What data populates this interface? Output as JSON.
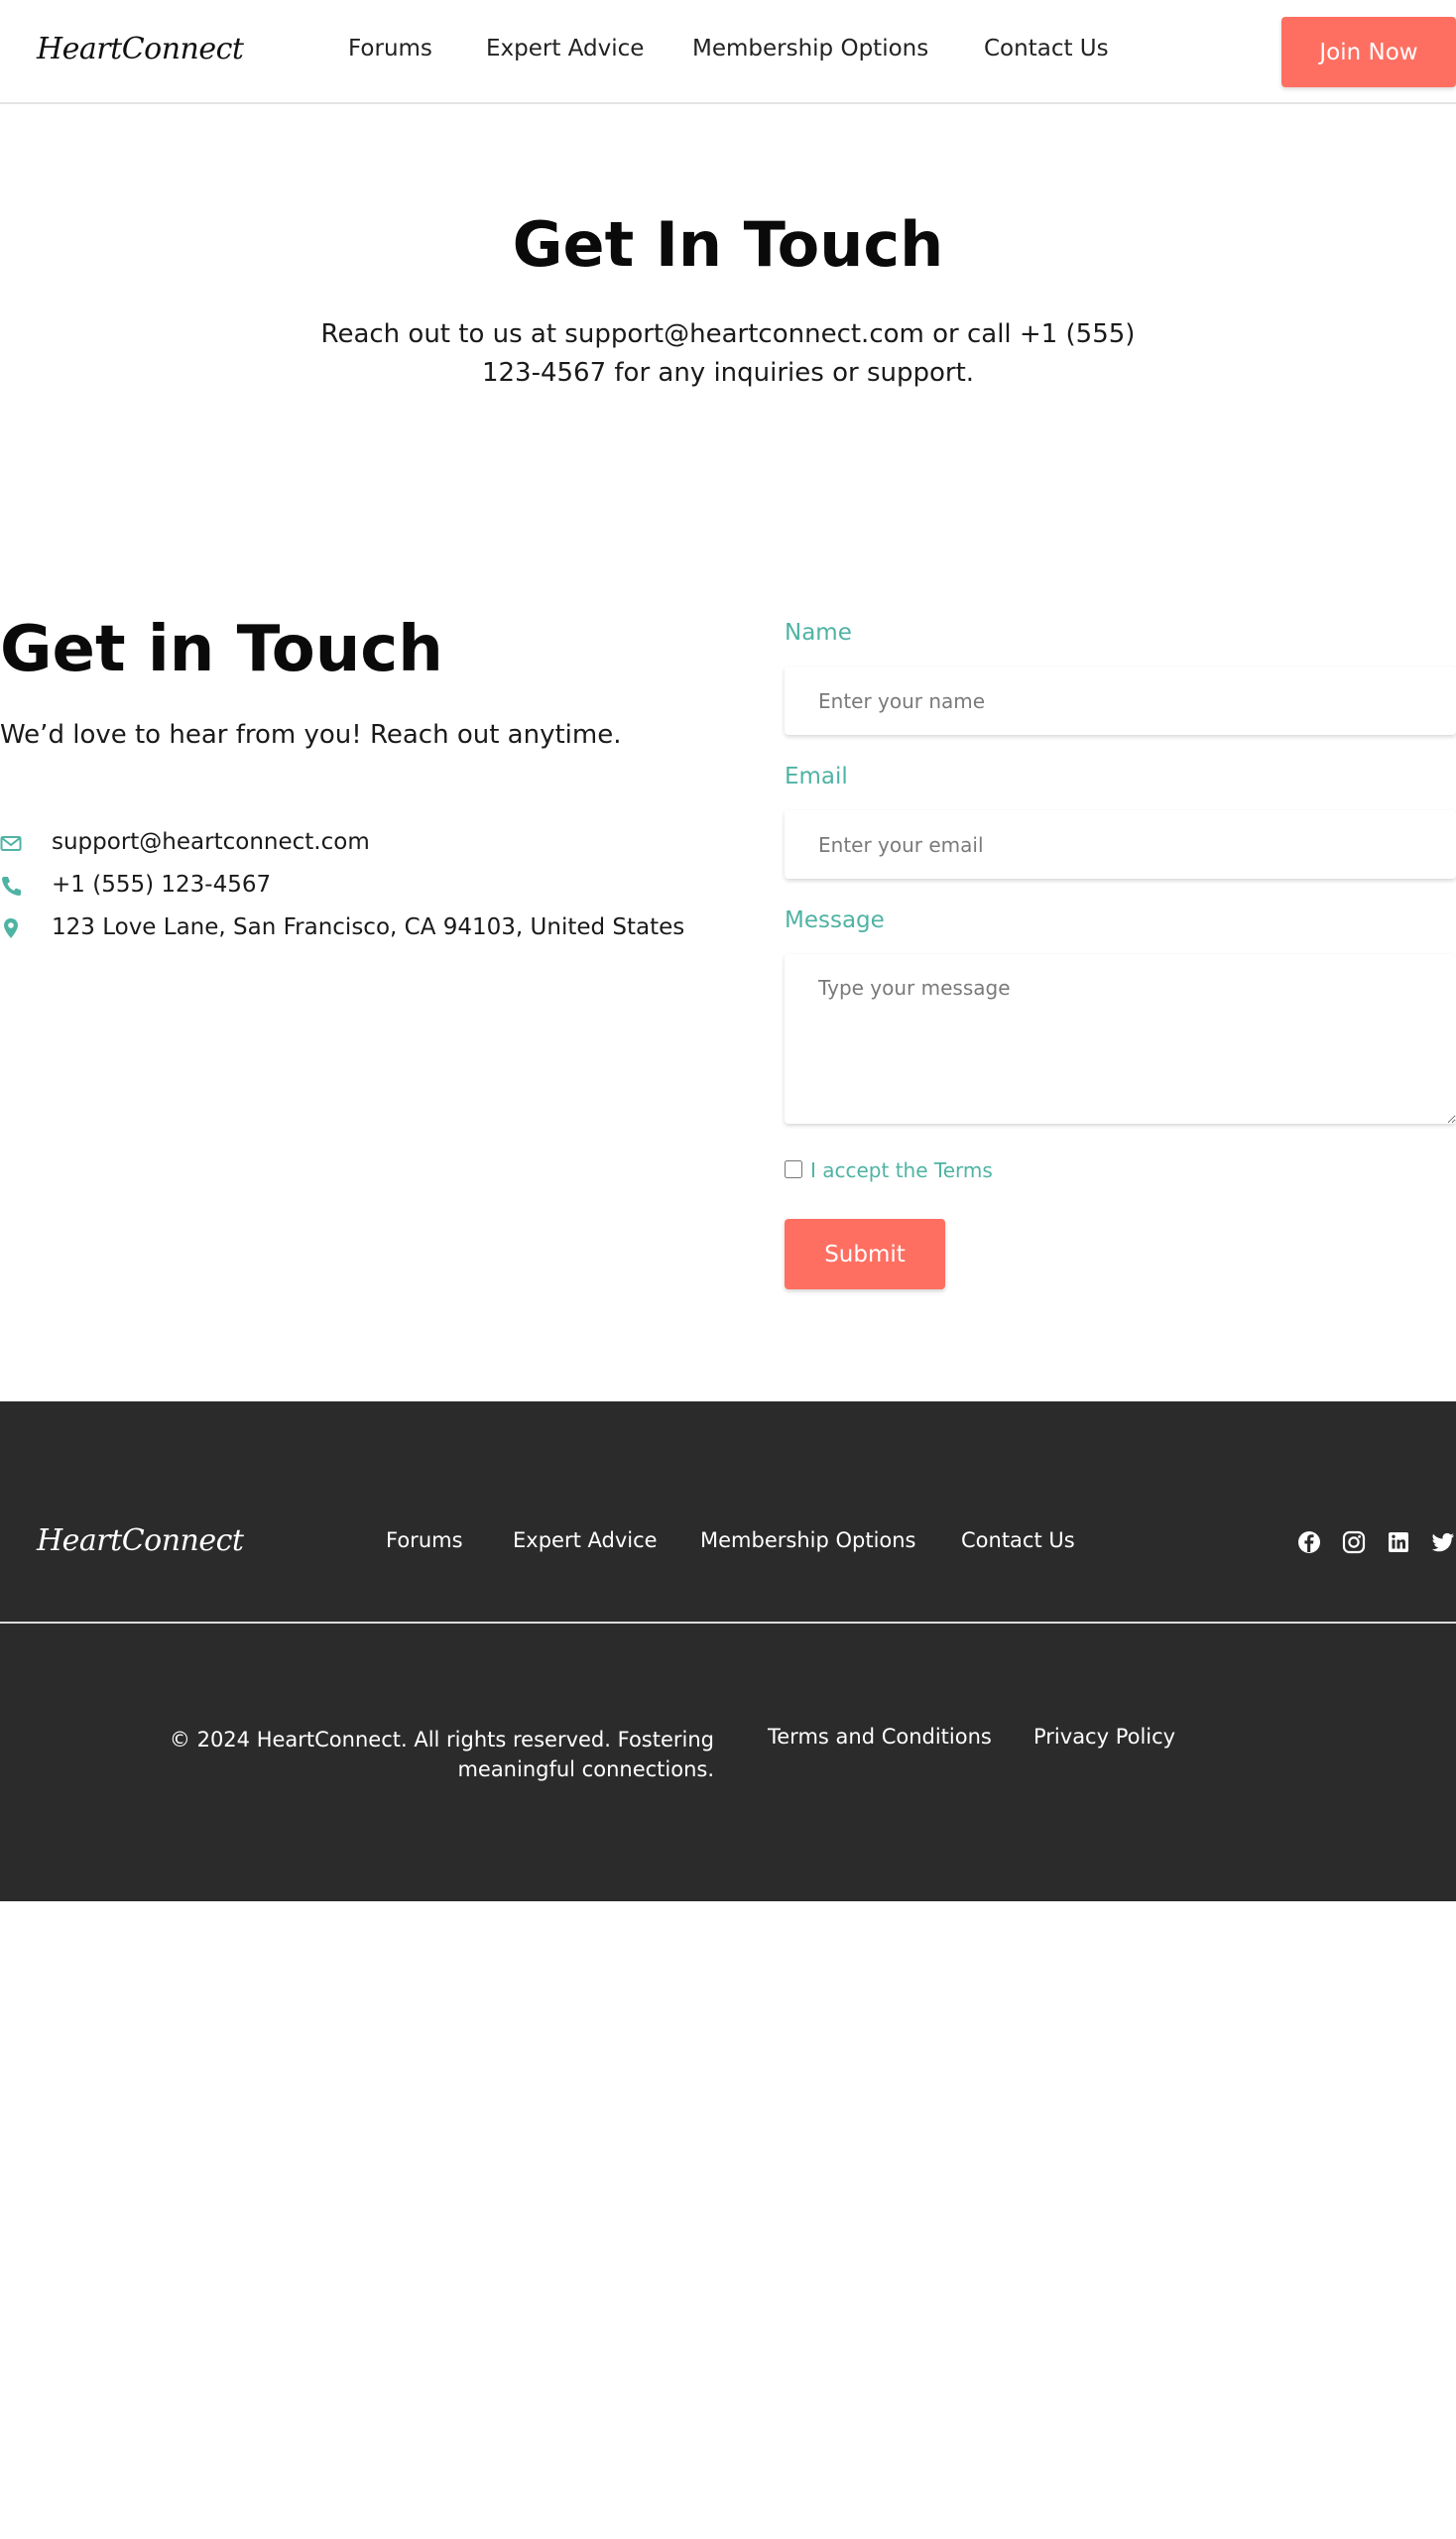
{
  "header": {
    "logo": "HeartConnect",
    "nav": [
      "Forums",
      "Expert Advice",
      "Membership Options",
      "Contact Us"
    ],
    "join_label": "Join Now"
  },
  "hero": {
    "title": "Get In Touch",
    "text": "Reach out to us at support@heartconnect.com or call +1 (555) 123-4567 for any inquiries or support."
  },
  "contact": {
    "title": "Get in Touch",
    "subtitle": "We’d love to hear from you! Reach out anytime.",
    "email": "support@heartconnect.com",
    "phone": "+1 (555) 123-4567",
    "address": "123 Love Lane, San Francisco, CA 94103, United States",
    "icons": [
      "envelope-icon",
      "phone-icon",
      "map-pin-icon"
    ]
  },
  "form": {
    "name_label": "Name",
    "name_placeholder": "Enter your name",
    "email_label": "Email",
    "email_placeholder": "Enter your email",
    "message_label": "Message",
    "message_placeholder": "Type your message",
    "terms_label": "I accept the Terms",
    "submit_label": "Submit"
  },
  "footer": {
    "logo": "HeartConnect",
    "nav": [
      "Forums",
      "Expert Advice",
      "Membership Options",
      "Contact Us"
    ],
    "social": [
      "facebook-icon",
      "instagram-icon",
      "linkedin-icon",
      "twitter-icon"
    ],
    "copyright": "© 2024 HeartConnect. All rights reserved. Fostering meaningful connections.",
    "terms_link": "Terms and Conditions",
    "privacy_link": "Privacy Policy"
  },
  "colors": {
    "accent": "#ff6f61",
    "teal": "#4fb3a4",
    "footer_bg": "#2b2b2b"
  }
}
